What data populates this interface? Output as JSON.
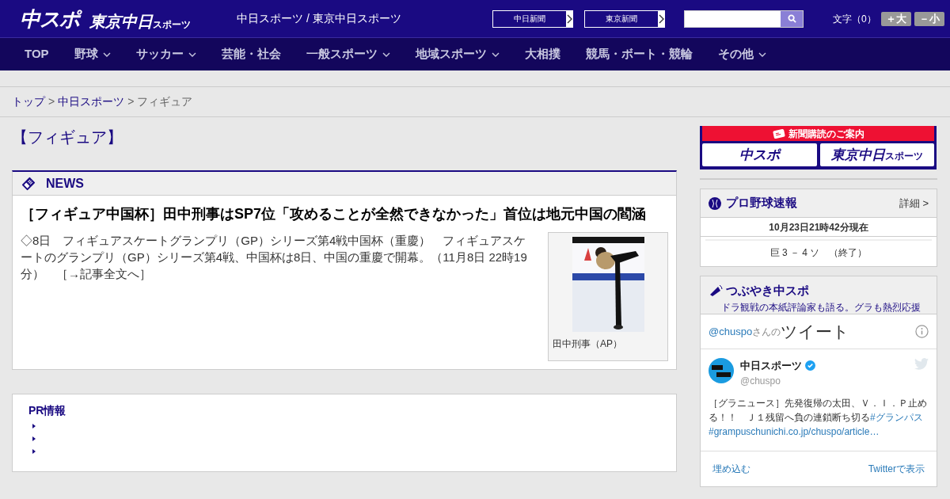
{
  "header": {
    "logo_main": "中スポ",
    "logo_second": "東京中日",
    "logo_second_small": "スポーツ",
    "tagline": "中日スポーツ / 東京中日スポーツ",
    "paper_links": [
      {
        "label": "中日新聞"
      },
      {
        "label": "東京新聞"
      }
    ],
    "font_size": {
      "label": "文字（0）",
      "buttons": [
        "＋大",
        "－小"
      ]
    }
  },
  "nav": [
    {
      "label": "TOP",
      "has_menu": false
    },
    {
      "label": "野球",
      "has_menu": true
    },
    {
      "label": "サッカー",
      "has_menu": true
    },
    {
      "label": "芸能・社会",
      "has_menu": false
    },
    {
      "label": "一般スポーツ",
      "has_menu": true
    },
    {
      "label": "地域スポーツ",
      "has_menu": true
    },
    {
      "label": "大相撲",
      "has_menu": false
    },
    {
      "label": "競馬・ボート・競輪",
      "has_menu": false
    },
    {
      "label": "その他",
      "has_menu": true
    }
  ],
  "breadcrumb_separator": ">",
  "breadcrumb": [
    {
      "label": "トップ",
      "link": true
    },
    {
      "label": "中日スポーツ",
      "link": true
    },
    {
      "label": "フィギュア",
      "link": false
    }
  ],
  "page_title": "【フィギュア】",
  "news": {
    "heading": "NEWS",
    "headline": "［フィギュア中国杯］田中刑事はSP7位「攻めることが全然できなかった」首位は地元中国の閻涵",
    "summary": "◇8日　フィギュアスケートグランプリ（GP）シリーズ第4戦中国杯（重慶）　フィギュアスケートのグランプリ（GP）シリーズ第4戦、中国杯は8日、中国の重慶で開幕。（11月8日 22時19分）　［→記事全文へ］",
    "photo": {
      "kind": "picture",
      "caption": "田中刑事（AP）"
    }
  },
  "pr": {
    "heading": "PR情報"
  },
  "sidebar": {
    "subscribe": {
      "banner": "新聞購読のご案内",
      "logos": [
        "中スポ",
        "東京中日"
      ],
      "logo_small": "スポーツ"
    },
    "baseball": {
      "title": "プロ野球速報",
      "more": "詳細 >",
      "updated": "10月23日21時42分現在",
      "score": "巨 3 － 4 ソ　（終了）"
    },
    "tweets": {
      "title": "つぶやき中スポ",
      "subtitle": "ドラ観戦の本紙評論家も語る。グラも熱烈応援",
      "handle": "@chuspo",
      "handle_suffix": "さんの",
      "header": "ツイート",
      "tweet": {
        "name": "中日スポーツ",
        "verified": true,
        "user": "@chuspo",
        "text": "［グラニュース］先発復帰の太田、Ｖ．Ｉ．Ｐ止める！！　Ｊ１残留へ負の連鎖断ち切る",
        "hashtag": "#グランパス",
        "link": "#grampuschunichi.co.jp/chuspo/article…"
      },
      "embed": "埋め込む",
      "view": "Twitterで表示"
    }
  }
}
